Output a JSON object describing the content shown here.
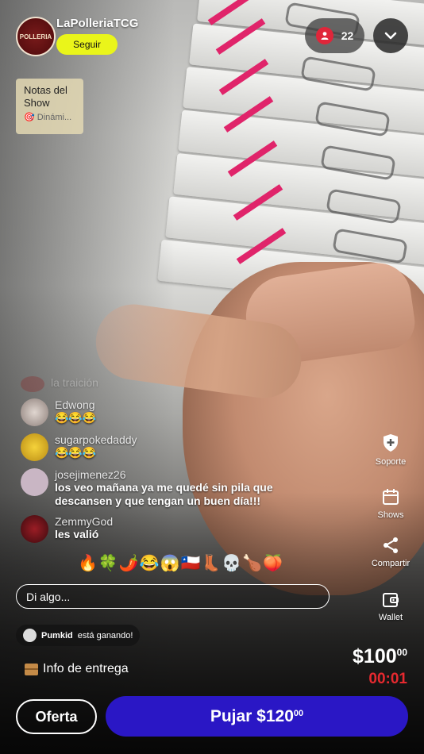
{
  "stream": {
    "username": "LaPolleriaTCG",
    "follow_label": "Seguir",
    "viewer_count": "22",
    "avatar_text": "POLLERIA"
  },
  "notes": {
    "title": "Notas del Show",
    "subtitle": "🎯 Dinámi..."
  },
  "chat": [
    {
      "user": "la traición",
      "message": ""
    },
    {
      "user": "Edwong",
      "message": "😂😂😂"
    },
    {
      "user": "sugarpokedaddy",
      "message": "😂😂😂"
    },
    {
      "user": "josejimenez26",
      "message": "los veo mañana ya me quedé sin pila que descansen y que tengan un buen día!!!"
    },
    {
      "user": "ZemmyGod",
      "message": "les valió"
    }
  ],
  "reactions": "🔥🍀🌶️😂😱🇨🇱👢💀🍗🍑",
  "input": {
    "placeholder": "Di algo..."
  },
  "winner": {
    "name": "Pumkid",
    "text": "está ganando!"
  },
  "delivery": {
    "label": "Info de entrega"
  },
  "rail": {
    "support": "Soporte",
    "shows": "Shows",
    "share": "Compartir",
    "wallet": "Wallet"
  },
  "auction": {
    "price_main": "$100",
    "price_cents": "00",
    "timer": "00:01",
    "offer_label": "Oferta",
    "bid_main": "Pujar $120",
    "bid_cents": "00"
  },
  "colors": {
    "follow": "#eaf51a",
    "bid": "#2a17c5",
    "timer": "#e6292f",
    "viewer_badge": "#e0263a"
  }
}
